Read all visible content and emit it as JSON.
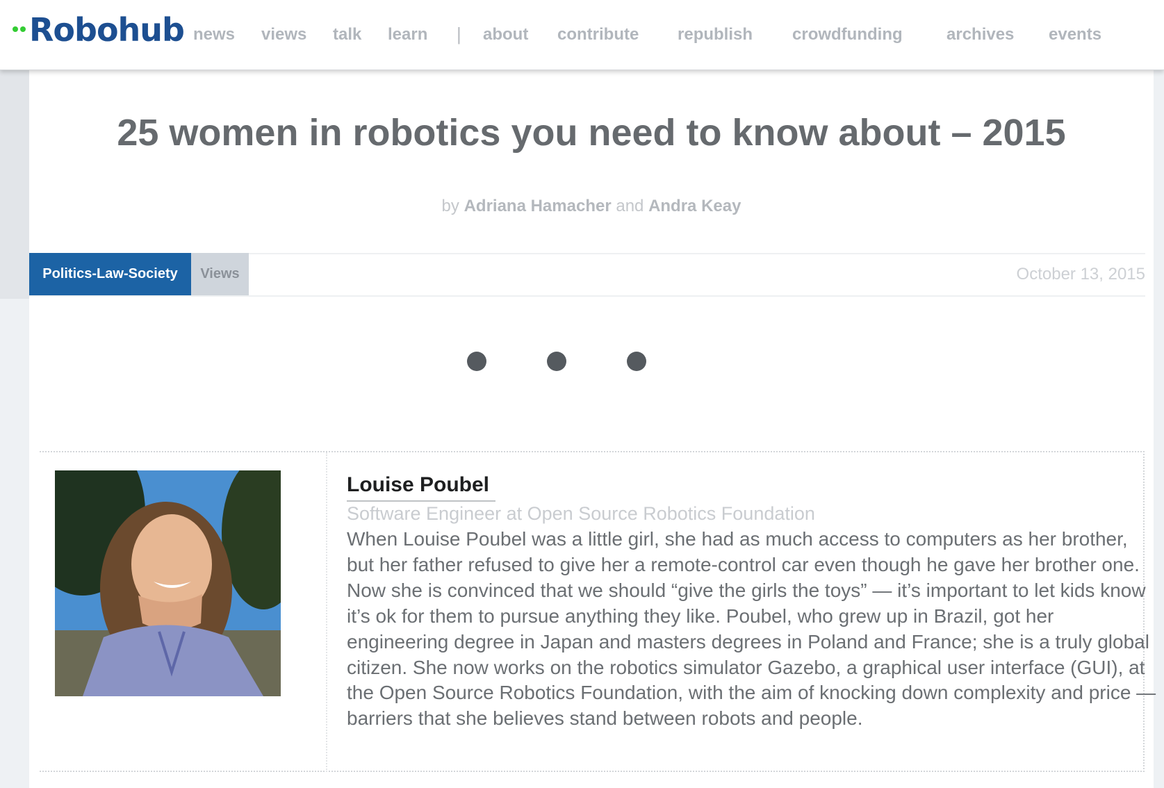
{
  "site": {
    "logo_text": "Robohub"
  },
  "nav": {
    "items": [
      {
        "label": "news"
      },
      {
        "label": "views"
      },
      {
        "label": "talk"
      },
      {
        "label": "learn"
      },
      {
        "label": "about"
      },
      {
        "label": "contribute"
      },
      {
        "label": "republish"
      },
      {
        "label": "crowdfunding"
      },
      {
        "label": "archives"
      },
      {
        "label": "events"
      }
    ],
    "separator": "|"
  },
  "article": {
    "title": "25 women in robotics you need to know about – 2015",
    "byline": {
      "prefix": "by",
      "author1": "Adriana Hamacher",
      "conjunction": "and",
      "author2": "Andra Keay"
    },
    "categories": [
      "Politics-Law-Society",
      "Views"
    ],
    "date": "October 13, 2015"
  },
  "profile": {
    "name": "Louise Poubel",
    "role": "Software Engineer at Open Source Robotics Foundation",
    "bio": "When Louise Poubel was a little girl, she had as much access to computers as her brother, but her father refused to give her a remote-control car even though he gave her brother one. Now she is convinced that we should “give the girls the toys” — it’s important to let kids know it’s ok for them to pursue anything they like. Poubel, who grew up in Brazil, got her engineering degree in Japan and masters degrees in Poland and France; she is a truly global citizen. She now works on the robotics simulator Gazebo, a graphical user interface (GUI), at the Open Source Robotics Foundation, with the aim of knocking down complexity and price — barriers that she believes stand between robots and people."
  },
  "colors": {
    "brand_blue": "#1d4f91",
    "logo_green": "#33cc33",
    "category_primary": "#1c63a5",
    "category_secondary": "#cfd5dc"
  }
}
